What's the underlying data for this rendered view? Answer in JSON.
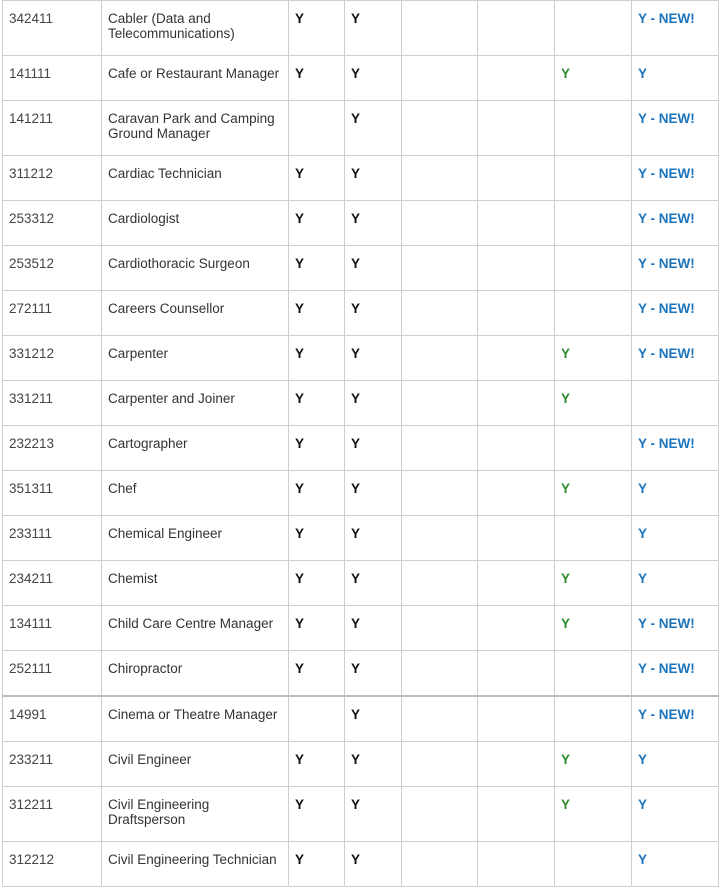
{
  "rows": [
    {
      "code": "342411",
      "occupation": "Cabler (Data and Telecommunications)",
      "a": "Y",
      "b": "Y",
      "c": "",
      "d": "",
      "e": "",
      "f": "Y - NEW!"
    },
    {
      "code": "141111",
      "occupation": "Cafe or Restaurant Manager",
      "a": "Y",
      "b": "Y",
      "c": "",
      "d": "",
      "e": "Y",
      "f": "Y"
    },
    {
      "code": "141211",
      "occupation": "Caravan Park and Camping Ground Manager",
      "a": "",
      "b": "Y",
      "c": "",
      "d": "",
      "e": "",
      "f": "Y - NEW!"
    },
    {
      "code": "311212",
      "occupation": "Cardiac Technician",
      "a": "Y",
      "b": "Y",
      "c": "",
      "d": "",
      "e": "",
      "f": "Y - NEW!"
    },
    {
      "code": "253312",
      "occupation": "Cardiologist",
      "a": "Y",
      "b": "Y",
      "c": "",
      "d": "",
      "e": "",
      "f": "Y - NEW!"
    },
    {
      "code": "253512",
      "occupation": "Cardiothoracic Surgeon",
      "a": "Y",
      "b": "Y",
      "c": "",
      "d": "",
      "e": "",
      "f": "Y - NEW!"
    },
    {
      "code": "272111",
      "occupation": "Careers Counsellor",
      "a": "Y",
      "b": "Y",
      "c": "",
      "d": "",
      "e": "",
      "f": "Y - NEW!"
    },
    {
      "code": "331212",
      "occupation": "Carpenter",
      "a": "Y",
      "b": "Y",
      "c": "",
      "d": "",
      "e": "Y",
      "f": "Y - NEW!"
    },
    {
      "code": "331211",
      "occupation": "Carpenter and Joiner",
      "a": "Y",
      "b": "Y",
      "c": "",
      "d": "",
      "e": "Y",
      "f": ""
    },
    {
      "code": "232213",
      "occupation": "Cartographer",
      "a": "Y",
      "b": "Y",
      "c": "",
      "d": "",
      "e": "",
      "f": "Y - NEW!"
    },
    {
      "code": "351311",
      "occupation": "Chef",
      "a": "Y",
      "b": "Y",
      "c": "",
      "d": "",
      "e": "Y",
      "f": "Y"
    },
    {
      "code": "233111",
      "occupation": "Chemical Engineer",
      "a": "Y",
      "b": "Y",
      "c": "",
      "d": "",
      "e": "",
      "f": "Y"
    },
    {
      "code": "234211",
      "occupation": "Chemist",
      "a": "Y",
      "b": "Y",
      "c": "",
      "d": "",
      "e": "Y",
      "f": "Y"
    },
    {
      "code": "134111",
      "occupation": "Child Care Centre Manager",
      "a": "Y",
      "b": "Y",
      "c": "",
      "d": "",
      "e": "Y",
      "f": "Y - NEW!"
    },
    {
      "code": "252111",
      "occupation": "Chiropractor",
      "a": "Y",
      "b": "Y",
      "c": "",
      "d": "",
      "e": "",
      "f": "Y - NEW!"
    },
    {
      "code": "14991",
      "occupation": "Cinema or Theatre Manager",
      "a": "",
      "b": "Y",
      "c": "",
      "d": "",
      "e": "",
      "f": "Y - NEW!"
    },
    {
      "code": "233211",
      "occupation": "Civil Engineer",
      "a": "Y",
      "b": "Y",
      "c": "",
      "d": "",
      "e": "Y",
      "f": "Y"
    },
    {
      "code": "312211",
      "occupation": "Civil Engineering Draftsperson",
      "a": "Y",
      "b": "Y",
      "c": "",
      "d": "",
      "e": "Y",
      "f": "Y"
    },
    {
      "code": "312212",
      "occupation": "Civil Engineering Technician",
      "a": "Y",
      "b": "Y",
      "c": "",
      "d": "",
      "e": "",
      "f": "Y"
    }
  ],
  "colors": {
    "border": "#cfcfcf",
    "flag_black": "#111111",
    "flag_green": "#2e8b2e",
    "flag_blue": "#1c75bc"
  }
}
